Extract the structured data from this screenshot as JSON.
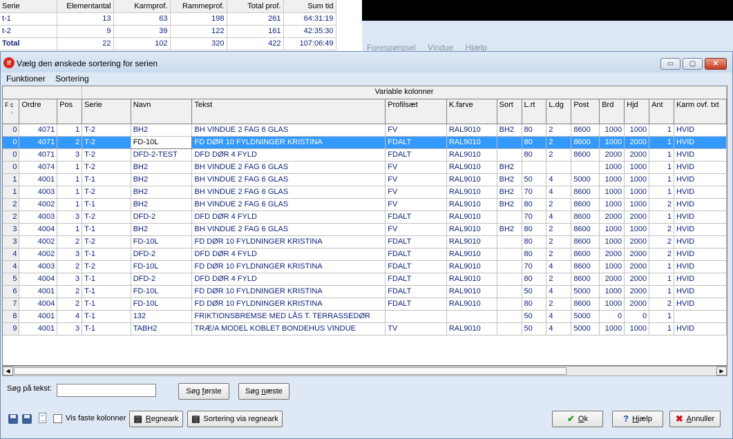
{
  "background": {
    "summary_headers": [
      "Serie",
      "Elementantal",
      "Karmprof.",
      "Rammeprof.",
      "Total prof.",
      "Sum tid"
    ],
    "summary_rows": [
      [
        "t-1",
        "13",
        "63",
        "198",
        "261",
        "64:31:19"
      ],
      [
        "t-2",
        "9",
        "39",
        "122",
        "161",
        "42:35:30"
      ],
      [
        "Total",
        "22",
        "102",
        "320",
        "422",
        "107:06:49"
      ]
    ],
    "menu": [
      "Forespørgsel",
      "Vindue",
      "Hjælp"
    ]
  },
  "dialog": {
    "title": "Vælg den ønskede sortering for serien",
    "app_icon_text": "if",
    "window_controls": {
      "minimize": "▭",
      "maximize": "▢",
      "close": "✕"
    },
    "menu": [
      "Funktioner",
      "Sortering"
    ]
  },
  "grid": {
    "group_header": "Variable kolonner",
    "columns": [
      "F c",
      "Ordre",
      "Pos",
      "Serie",
      "Navn",
      "Tekst",
      "Profilsæt",
      "K.farve",
      "Sort",
      "L.rt",
      "L.dg",
      "Post",
      "Brd",
      "Hjd",
      "Ant",
      "Karm ovf. txt"
    ],
    "sort_indicator": "▵",
    "rows": [
      [
        "0",
        "4071",
        "1",
        "T-2",
        "BH2",
        "BH VINDUE 2 FAG 6 GLAS",
        "FV",
        "RAL9010",
        "BH2",
        "80",
        "2",
        "8600",
        "1000",
        "1000",
        "1",
        "HVID"
      ],
      [
        "0",
        "4071",
        "2",
        "T-2",
        "FD-10L",
        "FD DØR 10 FYLDNINGER KRISTINA",
        "FDALT",
        "RAL9010",
        "",
        "80",
        "2",
        "8600",
        "1000",
        "2000",
        "1",
        "HVID"
      ],
      [
        "0",
        "4071",
        "3",
        "T-2",
        "DFD-2-TEST",
        "DFD DØR 4 FYLD",
        "FDALT",
        "RAL9010",
        "",
        "80",
        "2",
        "8600",
        "2000",
        "2000",
        "1",
        "HVID"
      ],
      [
        "0",
        "4074",
        "1",
        "T-2",
        "BH2",
        "BH VINDUE 2 FAG 6 GLAS",
        "FV",
        "RAL9010",
        "BH2",
        "",
        "",
        "",
        "1000",
        "1000",
        "1",
        "HVID"
      ],
      [
        "1",
        "4001",
        "1",
        "T-1",
        "BH2",
        "BH VINDUE 2 FAG 6 GLAS",
        "FV",
        "RAL9010",
        "BH2",
        "50",
        "4",
        "5000",
        "1000",
        "1000",
        "1",
        "HVID"
      ],
      [
        "1",
        "4003",
        "1",
        "T-2",
        "BH2",
        "BH VINDUE 2 FAG 6 GLAS",
        "FV",
        "RAL9010",
        "BH2",
        "70",
        "4",
        "8600",
        "1000",
        "1000",
        "1",
        "HVID"
      ],
      [
        "2",
        "4002",
        "1",
        "T-1",
        "BH2",
        "BH VINDUE 2 FAG 6 GLAS",
        "FV",
        "RAL9010",
        "BH2",
        "80",
        "2",
        "8600",
        "1000",
        "1000",
        "2",
        "HVID"
      ],
      [
        "2",
        "4003",
        "3",
        "T-2",
        "DFD-2",
        "DFD DØR 4 FYLD",
        "FDALT",
        "RAL9010",
        "",
        "70",
        "4",
        "8600",
        "2000",
        "2000",
        "1",
        "HVID"
      ],
      [
        "3",
        "4004",
        "1",
        "T-1",
        "BH2",
        "BH VINDUE 2 FAG 6 GLAS",
        "FV",
        "RAL9010",
        "BH2",
        "80",
        "2",
        "8600",
        "1000",
        "1000",
        "2",
        "HVID"
      ],
      [
        "3",
        "4002",
        "2",
        "T-2",
        "FD-10L",
        "FD DØR 10 FYLDNINGER KRISTINA",
        "FDALT",
        "RAL9010",
        "",
        "80",
        "2",
        "8600",
        "1000",
        "2000",
        "2",
        "HVID"
      ],
      [
        "4",
        "4002",
        "3",
        "T-1",
        "DFD-2",
        "DFD DØR 4 FYLD",
        "FDALT",
        "RAL9010",
        "",
        "80",
        "2",
        "8600",
        "2000",
        "2000",
        "2",
        "HVID"
      ],
      [
        "4",
        "4003",
        "2",
        "T-2",
        "FD-10L",
        "FD DØR 10 FYLDNINGER KRISTINA",
        "FDALT",
        "RAL9010",
        "",
        "70",
        "4",
        "8600",
        "1000",
        "2000",
        "1",
        "HVID"
      ],
      [
        "5",
        "4004",
        "3",
        "T-1",
        "DFD-2",
        "DFD DØR 4 FYLD",
        "FDALT",
        "RAL9010",
        "",
        "80",
        "2",
        "8600",
        "2000",
        "2000",
        "1",
        "HVID"
      ],
      [
        "6",
        "4001",
        "2",
        "T-1",
        "FD-10L",
        "FD DØR 10 FYLDNINGER KRISTINA",
        "FDALT",
        "RAL9010",
        "",
        "50",
        "4",
        "5000",
        "1000",
        "2000",
        "1",
        "HVID"
      ],
      [
        "7",
        "4004",
        "2",
        "T-1",
        "FD-10L",
        "FD DØR 10 FYLDNINGER KRISTINA",
        "FDALT",
        "RAL9010",
        "",
        "80",
        "2",
        "8600",
        "1000",
        "2000",
        "2",
        "HVID"
      ],
      [
        "8",
        "4001",
        "4",
        "T-1",
        "132",
        "FRIKTIONSBREMSE MED LÅS T. TERRASSEDØR",
        "",
        "",
        "",
        "50",
        "4",
        "5000",
        "0",
        "0",
        "1",
        ""
      ],
      [
        "9",
        "4001",
        "3",
        "T-1",
        "TABH2",
        "TRÆ/A MODEL KOBLET BONDEHUS VINDUE",
        "TV",
        "RAL9010",
        "",
        "50",
        "4",
        "5000",
        "1000",
        "1000",
        "1",
        "HVID"
      ]
    ],
    "selected_row": 1
  },
  "scrollbar": {
    "left": "◀",
    "right": "▶"
  },
  "search": {
    "label": "Søg på tekst:",
    "value": "",
    "find_first": [
      "Søg ",
      "f",
      "ørste"
    ],
    "find_next": [
      "Søg ",
      "n",
      "æste"
    ]
  },
  "footer": {
    "fixed_columns_label": "Vis faste kolonner",
    "fixed_columns_checked": false,
    "spreadsheet": [
      "",
      "R",
      "egneark"
    ],
    "sort_via_spreadsheet": "Sortering via regneark",
    "ok": [
      "",
      "O",
      "k"
    ],
    "help": [
      "",
      "H",
      "jælp"
    ],
    "cancel": [
      "",
      "A",
      "nnuller"
    ],
    "ok_icon_glyph": "✔",
    "help_icon_glyph": "?",
    "cancel_icon_glyph": "✖",
    "sheet_icon_glyph": "▤",
    "colors": {
      "ok": "#1f9a1f",
      "help": "#1a3fa8",
      "cancel": "#c8141e",
      "selection": "#3399ff",
      "text": "#0b1f78"
    }
  }
}
